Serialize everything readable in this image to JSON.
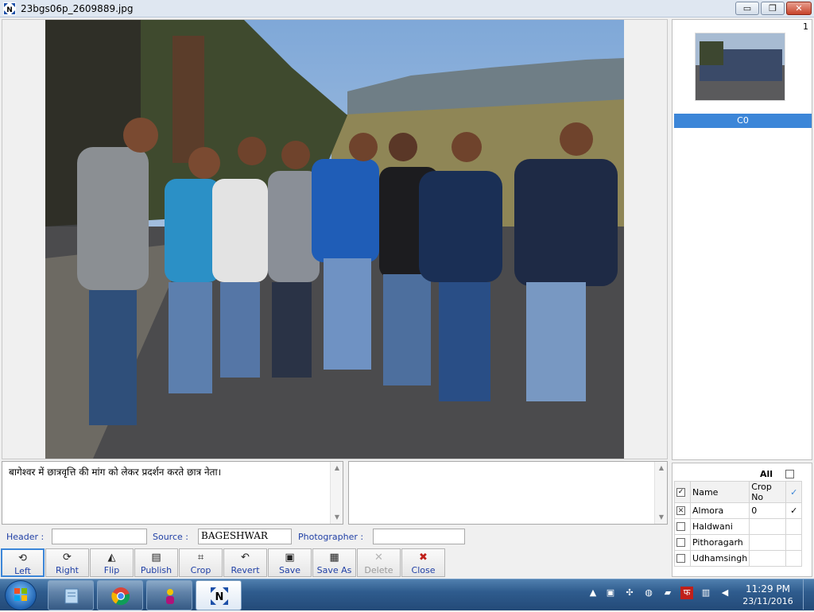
{
  "window": {
    "title": "23bgs06p_2609889.jpg",
    "controls": {
      "minimize": "▭",
      "maximize": "❐",
      "close": "✕"
    }
  },
  "viewer": {
    "image_alt": "photo of a group of young men raising fists on a hill road"
  },
  "thumbnails": {
    "count": "1",
    "items": [
      {
        "caption": "C0"
      }
    ]
  },
  "caption": {
    "text": "बागेश्वर में छात्रवृत्ति की मांग को लेकर प्रदर्शन करते छात्र नेता।",
    "secondary_text": ""
  },
  "meta": {
    "header_label": "Header :",
    "header_value": "",
    "source_label": "Source :",
    "source_value": "BAGESHWAR",
    "photographer_label": "Photographer :",
    "photographer_value": ""
  },
  "editions": {
    "all_label": "All",
    "columns": {
      "name": "Name",
      "crop": "Crop No",
      "mark": "✓"
    },
    "rows": [
      {
        "name": "Almora",
        "crop": "0",
        "mark": "✓",
        "checked": true
      },
      {
        "name": "Haldwani",
        "crop": "",
        "mark": "",
        "checked": false
      },
      {
        "name": "Pithoragarh",
        "crop": "",
        "mark": "",
        "checked": false
      },
      {
        "name": "Udhamsingh",
        "crop": "",
        "mark": "",
        "checked": false
      }
    ]
  },
  "toolbar": {
    "left": "Left",
    "right": "Right",
    "flip": "Flip",
    "publish": "Publish",
    "crop": "Crop",
    "revert": "Revert",
    "save": "Save",
    "save_as": "Save As",
    "delete": "Delete",
    "close": "Close"
  },
  "taskbar": {
    "apps": [
      "notepad-icon",
      "chrome-icon",
      "user-app-icon",
      "editor-app-icon"
    ],
    "time": "11:29 PM",
    "date": "23/11/2016"
  },
  "colors": {
    "accent": "#3c86d8",
    "label_blue": "#1f3fa5",
    "taskbar": "#2f5c8e"
  }
}
